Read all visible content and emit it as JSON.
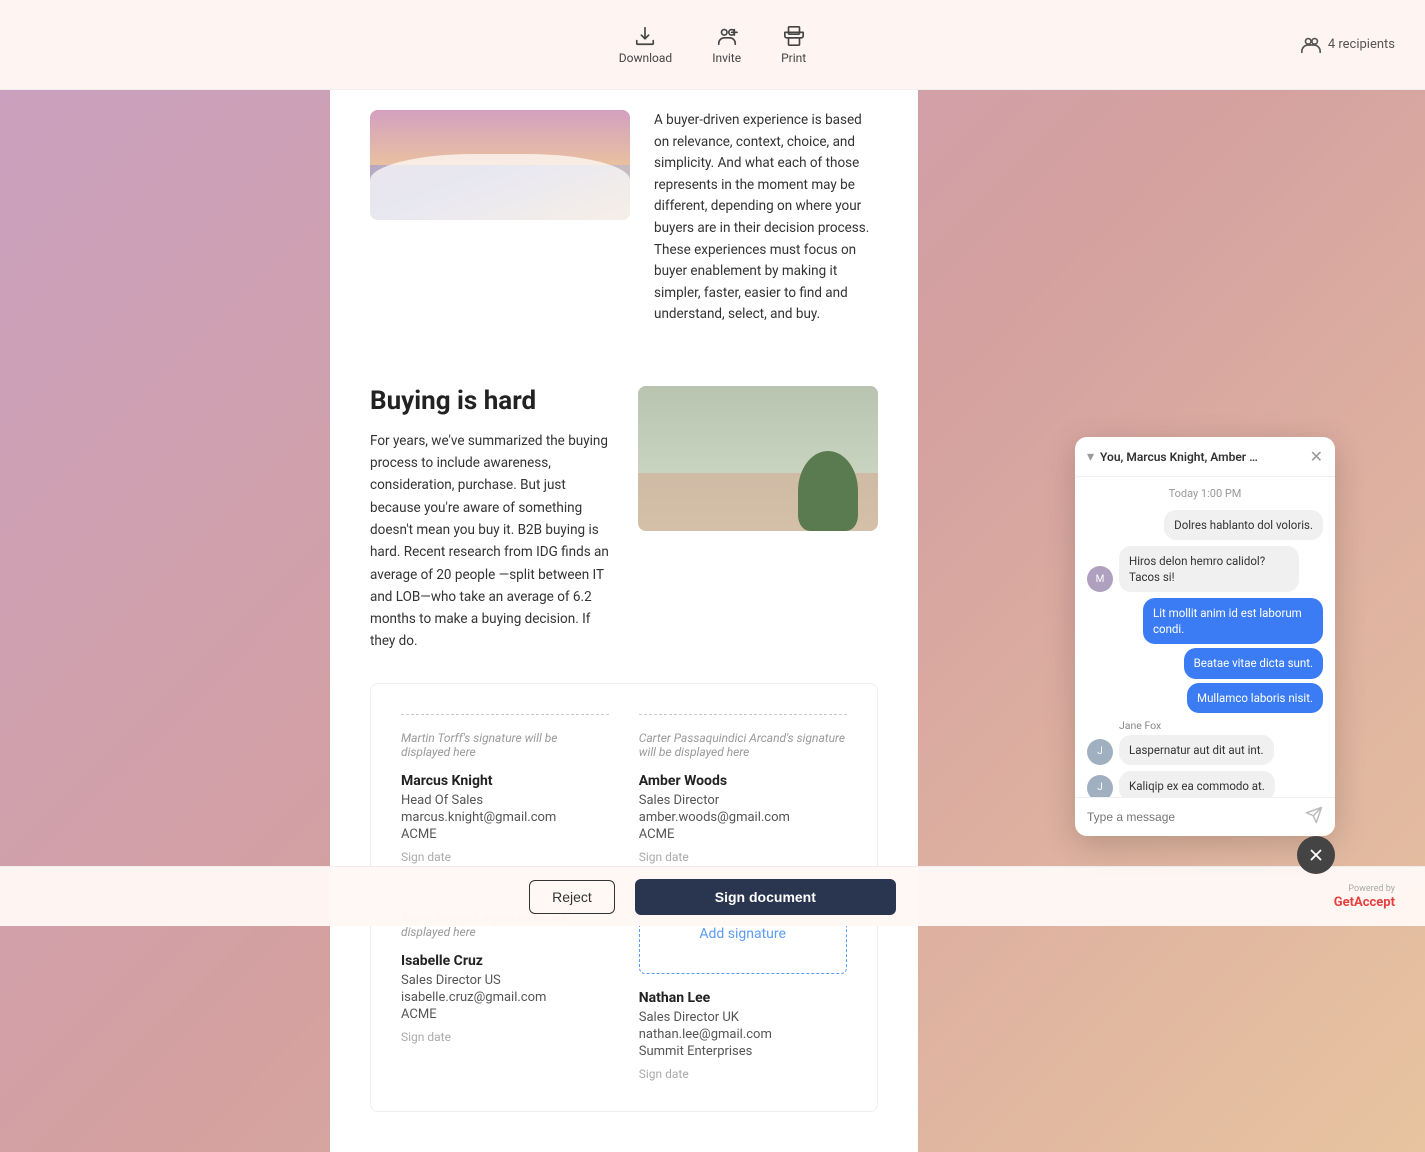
{
  "toolbar": {
    "download_label": "Download",
    "invite_label": "Invite",
    "print_label": "Print",
    "recipients_label": "4 recipients"
  },
  "document": {
    "intro_paragraph": "A buyer-driven experience is based on relevance, context, choice, and simplicity. And what each of those represents in the moment may be different, depending on where your buyers are in their decision process. These experiences must focus on buyer enablement by making it simpler, faster, easier to find and understand, select, and buy.",
    "buying_title": "Buying is hard",
    "buying_body": "For years, we've summarized the buying process to include awareness, consideration, purchase. But just because you're aware of something doesn't mean you buy it. B2B buying is hard. Recent research from IDG finds an average of 20 people —split between IT and LOB—who take an average of 6.2 months to make a buying decision. If they do.",
    "signatures": [
      {
        "placeholder": "Martin Torff's signature will be displayed here",
        "name": "Marcus Knight",
        "role": "Head Of Sales",
        "email": "marcus.knight@gmail.com",
        "company": "ACME",
        "date_label": "Sign date"
      },
      {
        "placeholder": "Carter Passaquindici Arcand's signature will be displayed here",
        "name": "Amber Woods",
        "role": "Sales Director",
        "email": "amber.woods@gmail.com",
        "company": "ACME",
        "date_label": "Sign date"
      },
      {
        "placeholder": "Roger George's signature will be displayed here",
        "name": "Isabelle Cruz",
        "role": "Sales Director US",
        "email": "isabelle.cruz@gmail.com",
        "company": "ACME",
        "date_label": "Sign date"
      },
      {
        "placeholder": "",
        "add_label": "Add signature",
        "name": "Nathan Lee",
        "role": "Sales Director UK",
        "email": "nathan.lee@gmail.com",
        "company": "Summit Enterprises",
        "date_label": "Sign date"
      }
    ]
  },
  "chat": {
    "title": "You, Marcus Knight, Amber Wo...",
    "date_label": "Today 1:00 PM",
    "messages": [
      {
        "type": "outgoing",
        "text": "Dolres hablanto dol voloris.",
        "bubble": "gray",
        "sender": ""
      },
      {
        "type": "incoming",
        "text": "Hiros delon hemro calidol? Tacos si!",
        "bubble": "gray",
        "sender": "marcus"
      },
      {
        "type": "outgoing",
        "text": "Lit mollit anim id est laborum condi.",
        "bubble": "blue"
      },
      {
        "type": "outgoing",
        "text": "Beatae vitae dicta sunt.",
        "bubble": "blue"
      },
      {
        "type": "outgoing",
        "text": "Mullamco laboris nisit.",
        "bubble": "blue"
      },
      {
        "type": "sender_label",
        "text": "Jane Fox"
      },
      {
        "type": "incoming2",
        "text": "Laspernatur aut dit aut int.",
        "bubble": "gray",
        "sender": "jane"
      },
      {
        "type": "incoming2",
        "text": "Kaliqip ex ea commodo at.",
        "bubble": "gray",
        "sender": "jane"
      }
    ],
    "input_placeholder": "Type a message"
  },
  "bottom_bar": {
    "reject_label": "Reject",
    "sign_label": "Sign document",
    "powered_by": "Powered by",
    "brand_get": "Get",
    "brand_accept": "Accept"
  }
}
